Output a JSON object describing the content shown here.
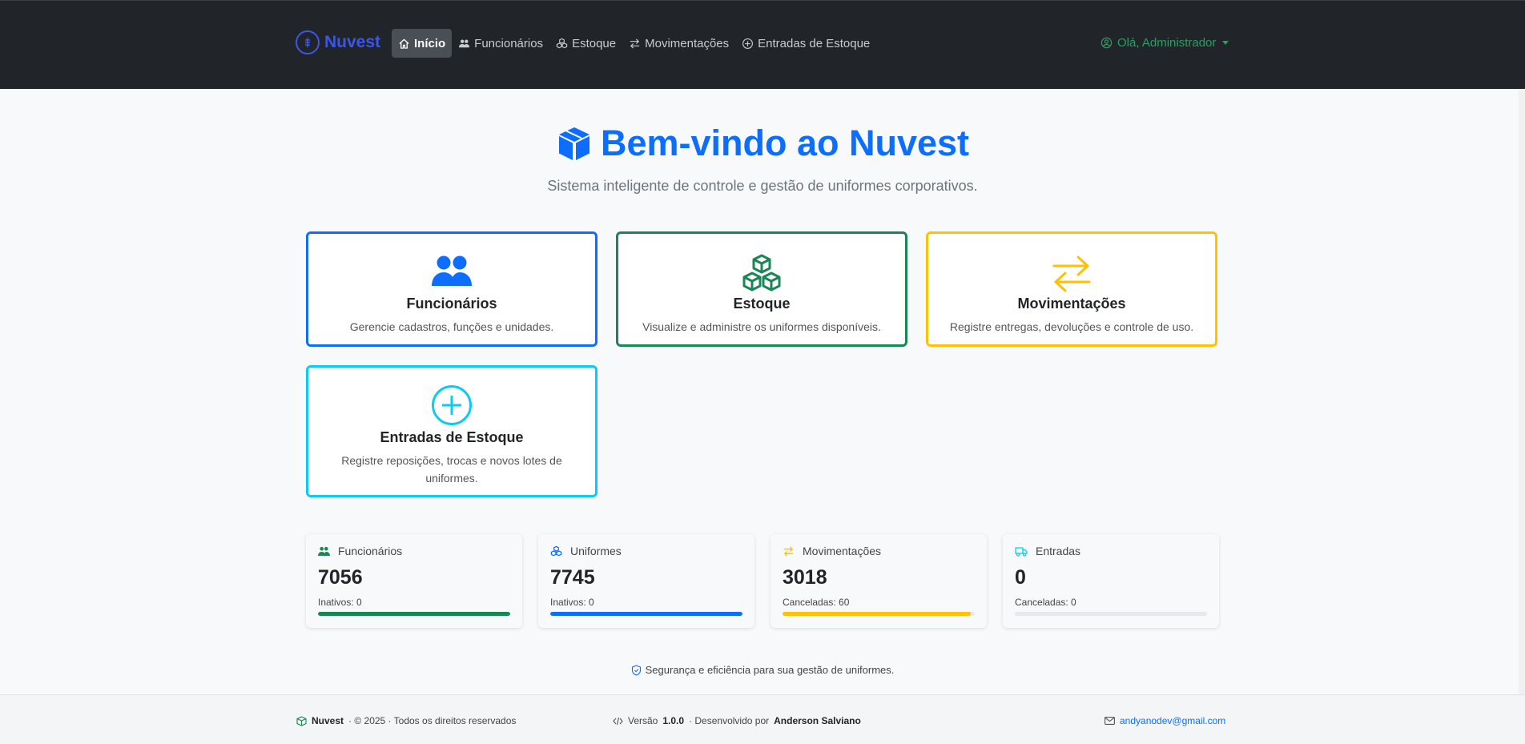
{
  "brand": {
    "name": "Nuvest"
  },
  "nav": {
    "items": [
      {
        "label": "Início",
        "icon": "home-icon",
        "active": true
      },
      {
        "label": "Funcionários",
        "icon": "people-icon"
      },
      {
        "label": "Estoque",
        "icon": "boxes-icon"
      },
      {
        "label": "Movimentações",
        "icon": "arrows-icon"
      },
      {
        "label": "Entradas de Estoque",
        "icon": "plus-circle-icon"
      }
    ],
    "user": "Olá, Administrador"
  },
  "hero": {
    "title": "Bem-vindo ao Nuvest",
    "subtitle": "Sistema inteligente de controle e gestão de uniformes corporativos."
  },
  "cards": [
    {
      "title": "Funcionários",
      "desc": "Gerencie cadastros, funções e unidades.",
      "color": "#0d6efd",
      "icon": "people-icon"
    },
    {
      "title": "Estoque",
      "desc": "Visualize e administre os uniformes disponíveis.",
      "color": "#198754",
      "icon": "boxes-icon"
    },
    {
      "title": "Movimentações",
      "desc": "Registre entregas, devoluções e controle de uso.",
      "color": "#ffc107",
      "icon": "arrows-icon"
    },
    {
      "title": "Entradas de Estoque",
      "desc": "Registre reposições, trocas e novos lotes de uniformes.",
      "color": "#0dcaf0",
      "icon": "plus-circle-icon"
    }
  ],
  "stats": [
    {
      "label": "Funcionários",
      "value": "7056",
      "sub": "Inativos: 0",
      "color": "#198754",
      "progress": 1.0
    },
    {
      "label": "Uniformes",
      "value": "7745",
      "sub": "Inativos: 0",
      "color": "#0d6efd",
      "progress": 1.0
    },
    {
      "label": "Movimentações",
      "value": "3018",
      "sub": "Canceladas: 60",
      "color": "#ffc107",
      "progress": 0.98
    },
    {
      "label": "Entradas",
      "value": "0",
      "sub": "Canceladas: 0",
      "color": "#0dcaf0",
      "progress": 0
    }
  ],
  "security": "Segurança e eficiência para sua gestão de uniformes.",
  "footer": {
    "brand": "Nuvest",
    "copyright": "· © 2025 · Todos os direitos reservados",
    "version_prefix": "Versão",
    "version": "1.0.0",
    "dev_prefix": "· Desenvolvido por",
    "developer": "Anderson Salviano",
    "email": "andyanodev@gmail.com"
  }
}
